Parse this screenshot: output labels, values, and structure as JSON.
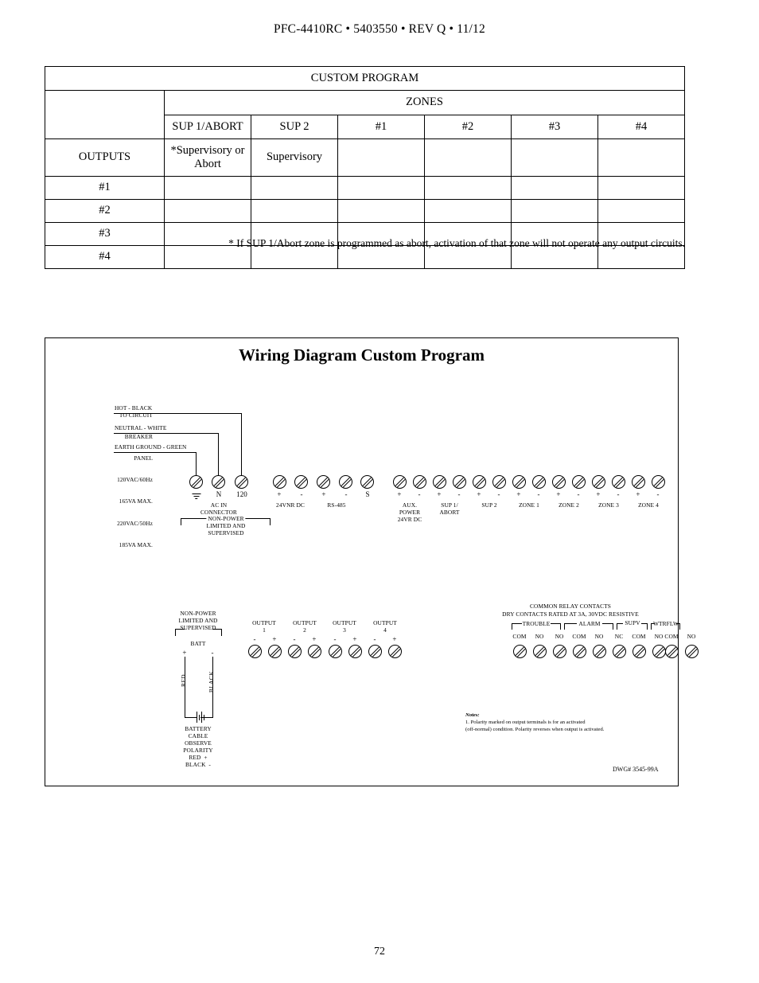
{
  "header": {
    "line": "PFC-4410RC • 5403550 • REV Q •  11/12"
  },
  "program_table": {
    "title": "CUSTOM PROGRAM",
    "zones_header": "ZONES",
    "column_headers": [
      "SUP 1/ABORT",
      "SUP 2",
      "#1",
      "#2",
      "#3",
      "#4"
    ],
    "outputs_label": "OUTPUTS",
    "type_row": [
      "*Supervisory or Abort",
      "Supervisory",
      "",
      "",
      "",
      ""
    ],
    "row_labels": [
      "#1",
      "#2",
      "#3",
      "#4"
    ],
    "body_rows": [
      [
        "",
        "",
        "",
        "",
        "",
        ""
      ],
      [
        "",
        "",
        "",
        "",
        "",
        ""
      ],
      [
        "",
        "",
        "",
        "",
        "",
        ""
      ],
      [
        "",
        "",
        "",
        "",
        "",
        ""
      ]
    ],
    "footnote": "* If SUP 1/Abort zone is programmed as abort, activation of that zone will not operate any output circuits."
  },
  "diagram": {
    "title": "Wiring Diagram Custom Program",
    "dwg_number": "DWG# 3545-99A",
    "mains": {
      "source_lines": [
        "TO CIRCUIT",
        "BREAKER",
        "PANEL",
        "120VAC/60Hz",
        "165VA MAX.",
        "220VAC/50Hz",
        "185VA MAX."
      ],
      "wire_hot": "HOT - BLACK",
      "wire_neutral": "NEUTRAL - WHITE",
      "wire_ground": "EARTH GROUND - GREEN"
    },
    "ac_in": {
      "terminal_labels": [
        "",
        "N",
        "120"
      ],
      "caption_line1": "AC IN",
      "caption_line2": "CONNECTOR",
      "bracket_label": "NON-POWER",
      "bracket_line2": "LIMITED AND",
      "bracket_line3": "SUPERVISED"
    },
    "aux_block": {
      "polarities": [
        "+",
        "-",
        "+",
        "-",
        "S"
      ],
      "groups": [
        {
          "label": "24VNR DC"
        },
        {
          "label": "RS-485"
        }
      ]
    },
    "zone_block": {
      "polarities": [
        "+",
        "-",
        "+",
        "-",
        "+",
        "-",
        "+",
        "-",
        "+",
        "-",
        "+",
        "-",
        "+",
        "-"
      ],
      "groups": [
        {
          "lines": [
            "AUX.",
            "POWER",
            "24VR DC"
          ]
        },
        {
          "lines": [
            "SUP 1/",
            "ABORT"
          ]
        },
        {
          "lines": [
            "SUP 2"
          ]
        },
        {
          "lines": [
            "ZONE 1"
          ]
        },
        {
          "lines": [
            "ZONE 2"
          ]
        },
        {
          "lines": [
            "ZONE 3"
          ]
        },
        {
          "lines": [
            "ZONE 4"
          ]
        }
      ]
    },
    "battery": {
      "bracket_line1": "NON-POWER",
      "bracket_line2": "LIMITED AND",
      "bracket_line3": "SUPERVISED",
      "batt_label": "BATT",
      "plus": "+",
      "minus": "-",
      "wire_red": "RED",
      "wire_black": "BLACK",
      "caption": [
        "BATTERY",
        "CABLE",
        "OBSERVE",
        "POLARITY",
        "RED  +",
        "BLACK  -"
      ]
    },
    "outputs": {
      "groups": [
        {
          "line1": "OUTPUT",
          "line2": "1",
          "polarities": [
            "-",
            "+"
          ]
        },
        {
          "line1": "OUTPUT",
          "line2": "2",
          "polarities": [
            "-",
            "+"
          ]
        },
        {
          "line1": "OUTPUT",
          "line2": "3",
          "polarities": [
            "-",
            "+"
          ]
        },
        {
          "line1": "OUTPUT",
          "line2": "4",
          "polarities": [
            "-",
            "+"
          ]
        }
      ]
    },
    "relays": {
      "title_line1": "COMMON RELAY CONTACTS",
      "title_line2": "DRY CONTACTS RATED AT 3A, 30VDC RESISTIVE",
      "groups": [
        {
          "name": "TROUBLE",
          "terminals": [
            "COM",
            "NO",
            "NO"
          ]
        },
        {
          "name": "ALARM",
          "terminals": [
            "COM",
            "NO",
            "NC"
          ]
        },
        {
          "name": "SUPV",
          "terminals": [
            "COM",
            "NO"
          ]
        },
        {
          "name": "WTRFLW",
          "terminals": [
            "COM",
            "NO"
          ]
        }
      ]
    },
    "notes": {
      "title": "Notes:",
      "line1": "1.  Polarity marked on output terminals is for an activated",
      "line2": "(off-normal) condition. Polarity reverses when output is activated."
    }
  },
  "page_number": "72"
}
